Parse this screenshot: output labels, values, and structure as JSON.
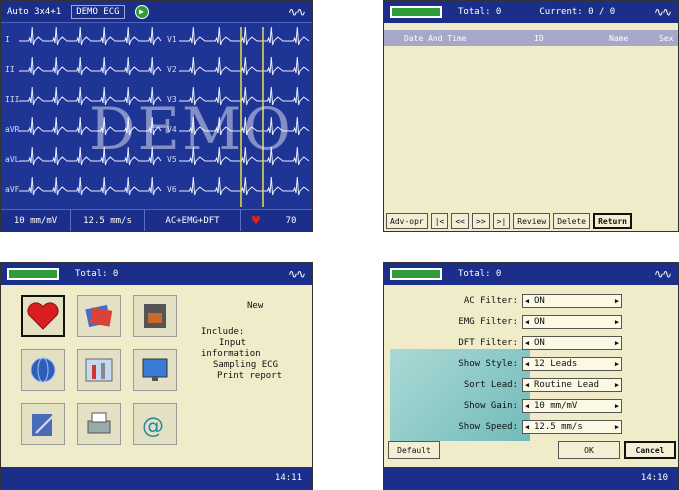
{
  "ecg_screen": {
    "mode": "Auto 3x4+1",
    "demo_button": "DEMO ECG",
    "leads_left": [
      "I",
      "II",
      "III",
      "aVR",
      "aVL",
      "aVF"
    ],
    "leads_right": [
      "V1",
      "V2",
      "V3",
      "V4",
      "V5",
      "V6"
    ],
    "watermark": "DEMO",
    "sensitivity": "10 mm/mV",
    "speed": "12.5 mm/s",
    "filters": "AC+EMG+DFT",
    "heart_rate": "70"
  },
  "record_list": {
    "total": "Total: 0",
    "current": "Current: 0 / 0",
    "columns": [
      "Date And Time",
      "ID",
      "Name",
      "Sex"
    ],
    "buttons": [
      "Adv-opr",
      "|<",
      "<<",
      ">>",
      ">|",
      "Review",
      "Delete",
      "Return"
    ]
  },
  "main_menu": {
    "total": "Total: 0",
    "side_title": "New",
    "side_lines": [
      "Include:",
      "Input",
      "information",
      "Sampling ECG",
      "Print report"
    ],
    "time": "14:11"
  },
  "settings": {
    "total": "Total: 0",
    "rows": [
      {
        "label": "AC Filter:",
        "value": "ON"
      },
      {
        "label": "EMG Filter:",
        "value": "ON"
      },
      {
        "label": "DFT Filter:",
        "value": "ON"
      },
      {
        "label": "Show Style:",
        "value": "12 Leads"
      },
      {
        "label": "Sort Lead:",
        "value": "Routine Lead"
      },
      {
        "label": "Show Gain:",
        "value": "10 mm/mV"
      },
      {
        "label": "Show Speed:",
        "value": "12.5 mm/s"
      }
    ],
    "default_button": "Default",
    "ok_button": "OK",
    "cancel_button": "Cancel",
    "time": "14:10"
  },
  "colors": {
    "bar_blue": "#1b2f8a",
    "ecg_bg": "#1f3596",
    "panel_beige": "#f0ebc8",
    "battery_green": "#2f9d3a"
  }
}
